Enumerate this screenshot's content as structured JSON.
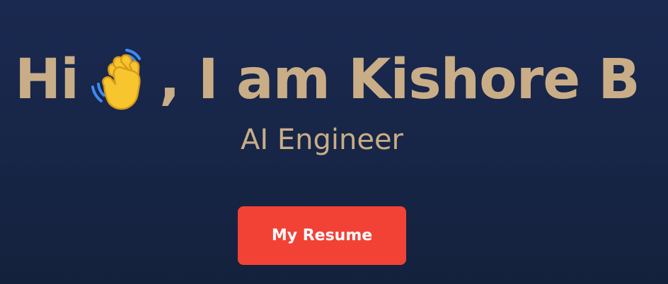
{
  "hero": {
    "greeting": "Hi",
    "wave_icon": "waving-hand-icon",
    "name_text": ", I am Kishore B",
    "subtitle": "AI Engineer",
    "resume_button_label": "My Resume"
  },
  "colors": {
    "background": "#172546",
    "text_accent": "#c9ad86",
    "button": "#f24236",
    "button_text": "#ffffff",
    "hand": "#f7c52d",
    "motion_lines": "#3d8bf2"
  }
}
